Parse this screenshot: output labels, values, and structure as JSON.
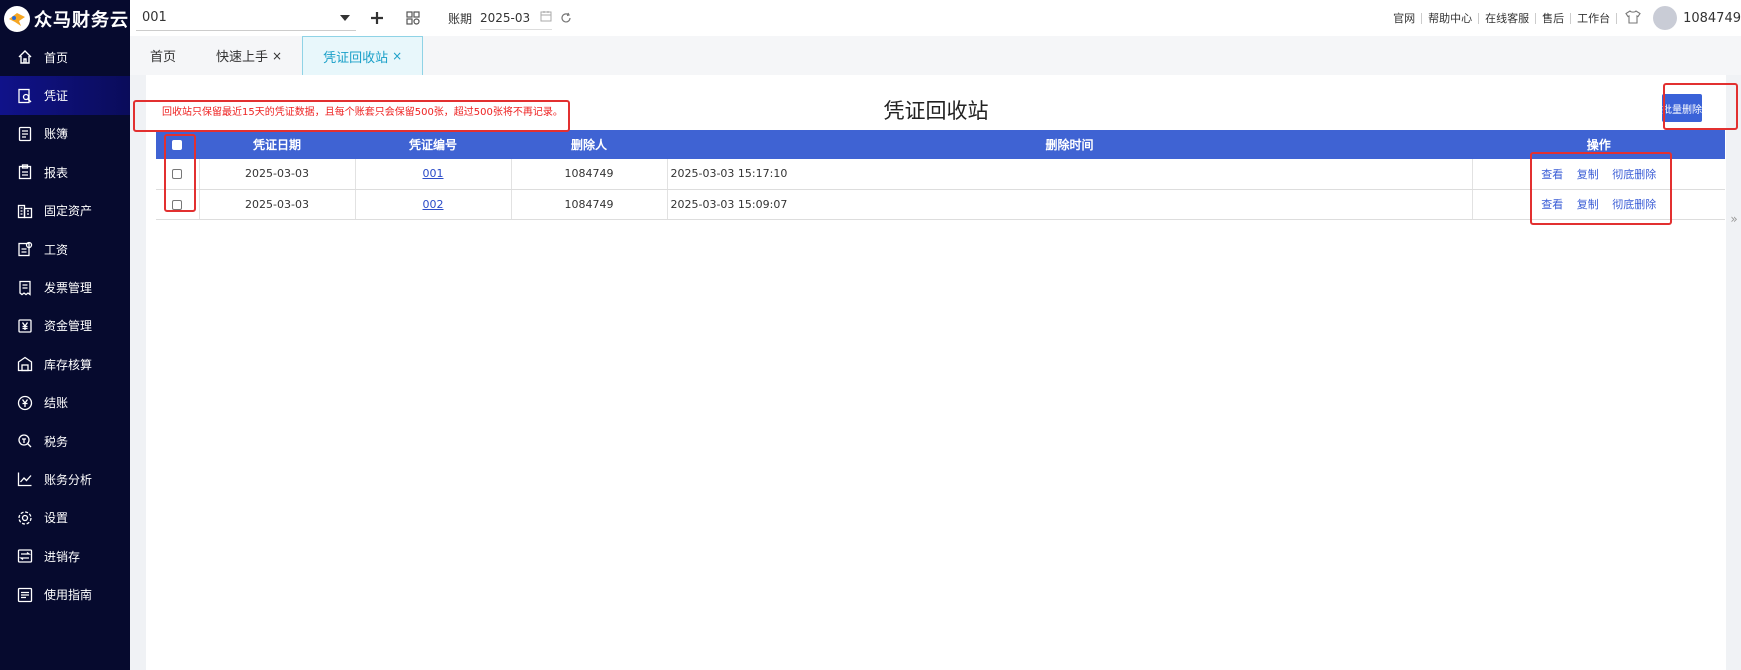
{
  "app": {
    "name": "众马财务云"
  },
  "sidebar": {
    "items": [
      {
        "label": "首页",
        "icon": "home-icon",
        "active": false
      },
      {
        "label": "凭证",
        "icon": "voucher-search-icon",
        "active": true
      },
      {
        "label": "账簿",
        "icon": "ledger-icon",
        "active": false
      },
      {
        "label": "报表",
        "icon": "report-icon",
        "active": false
      },
      {
        "label": "固定资产",
        "icon": "building-icon",
        "active": false
      },
      {
        "label": "工资",
        "icon": "payroll-icon",
        "active": false
      },
      {
        "label": "发票管理",
        "icon": "invoice-icon",
        "active": false
      },
      {
        "label": "资金管理",
        "icon": "yen-box-icon",
        "active": false
      },
      {
        "label": "库存核算",
        "icon": "warehouse-icon",
        "active": false
      },
      {
        "label": "结账",
        "icon": "yen-circle-icon",
        "active": false
      },
      {
        "label": "税务",
        "icon": "tax-icon",
        "active": false
      },
      {
        "label": "账务分析",
        "icon": "line-chart-icon",
        "active": false
      },
      {
        "label": "设置",
        "icon": "gear-icon",
        "active": false
      },
      {
        "label": "进销存",
        "icon": "exchange-icon",
        "active": false
      },
      {
        "label": "使用指南",
        "icon": "guide-icon",
        "active": false
      }
    ]
  },
  "topbar": {
    "book": "001",
    "period_label": "账期",
    "period_value": "2025-03",
    "links": [
      "官网",
      "帮助中心",
      "在线客服",
      "售后",
      "工作台"
    ],
    "user_id": "1084749"
  },
  "tabs": [
    {
      "label": "首页",
      "closable": false,
      "active": false
    },
    {
      "label": "快速上手",
      "closable": true,
      "active": false
    },
    {
      "label": "凭证回收站",
      "closable": true,
      "active": true
    }
  ],
  "page": {
    "title": "凭证回收站",
    "notice": "回收站只保留最近15天的凭证数据，且每个账套只会保留500张，超过500张将不再记录。",
    "batch_delete_label": "批量删除"
  },
  "table": {
    "columns": [
      "凭证日期",
      "凭证编号",
      "删除人",
      "删除时间",
      "操作"
    ],
    "rows": [
      {
        "date": "2025-03-03",
        "number": "001",
        "deleter": "1084749",
        "deleted_at": "2025-03-03 15:17:10"
      },
      {
        "date": "2025-03-03",
        "number": "002",
        "deleter": "1084749",
        "deleted_at": "2025-03-03 15:09:07"
      }
    ],
    "actions": [
      "查看",
      "复制",
      "彻底删除"
    ]
  },
  "colors": {
    "sidebar_bg": "#060a2e",
    "header_blue": "#3f63d3",
    "highlight_red": "#e23030",
    "tab_active": "#1aa0c8"
  }
}
